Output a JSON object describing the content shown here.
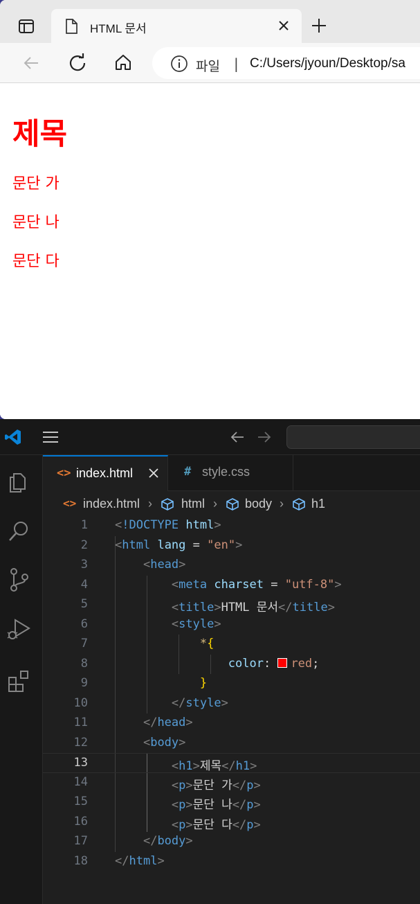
{
  "browser": {
    "tab_title": "HTML 문서",
    "address": {
      "scheme_label": "파일",
      "separator": "|",
      "url": "C:/Users/jyoun/Desktop/sa"
    }
  },
  "page": {
    "h1": "제목",
    "paragraphs": [
      "문단 가",
      "문단 나",
      "문단 다"
    ],
    "text_color": "#ff0000"
  },
  "vscode": {
    "tabs": [
      {
        "icon": "<>",
        "label": "index.html",
        "active": true
      },
      {
        "icon": "#",
        "label": "style.css",
        "active": false
      }
    ],
    "breadcrumbs": [
      "index.html",
      "html",
      "body",
      "h1"
    ],
    "current_line": 13,
    "lines": [
      {
        "n": "1"
      },
      {
        "n": "2"
      },
      {
        "n": "3"
      },
      {
        "n": "4"
      },
      {
        "n": "5"
      },
      {
        "n": "6"
      },
      {
        "n": "7"
      },
      {
        "n": "8"
      },
      {
        "n": "9"
      },
      {
        "n": "10"
      },
      {
        "n": "11"
      },
      {
        "n": "12"
      },
      {
        "n": "13"
      },
      {
        "n": "14"
      },
      {
        "n": "15"
      },
      {
        "n": "16"
      },
      {
        "n": "17"
      },
      {
        "n": "18"
      }
    ],
    "code": {
      "l1_doctype": "!DOCTYPE",
      "l1_html": "html",
      "l2_tag": "html",
      "l2_attr": "lang",
      "l2_eq": " = ",
      "l2_val": "\"en\"",
      "l3_tag": "head",
      "l4_tag": "meta",
      "l4_attr": "charset",
      "l4_eq": " = ",
      "l4_val": "\"utf-8\"",
      "l5_tag": "title",
      "l5_text": "HTML 문서",
      "l6_tag": "style",
      "l7_selector": "*",
      "l7_brace": "{",
      "l8_prop": "color",
      "l8_colon": ": ",
      "l8_value": "red",
      "l8_semi": ";",
      "l8_swatch_color": "#ff0000",
      "l9_brace": "}",
      "l10_tag": "style",
      "l11_tag": "head",
      "l12_tag": "body",
      "l13_tag": "h1",
      "l13_text": "제목",
      "l14_tag": "p",
      "l14_text": "문단 가",
      "l15_tag": "p",
      "l15_text": "문단 나",
      "l16_tag": "p",
      "l16_text": "문단 다",
      "l17_tag": "body",
      "l18_tag": "html"
    }
  }
}
